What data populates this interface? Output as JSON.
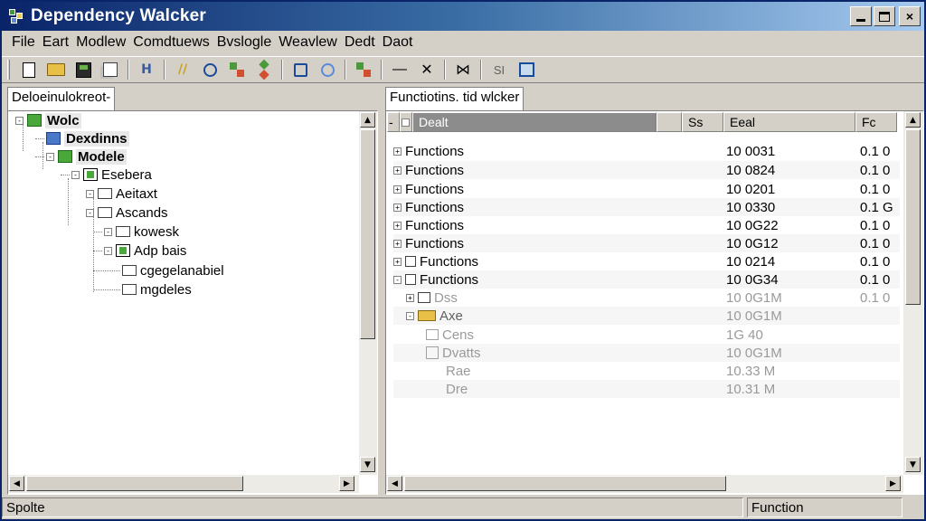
{
  "window": {
    "title": "Dependency Walcker",
    "buttons": {
      "minimize": "minimize",
      "maximize": "maximize",
      "close": "×"
    }
  },
  "menu": [
    "File",
    "Eart",
    "Modlew",
    "Comdtuews",
    "Bvslogle",
    "Weavlew",
    "Dedt",
    "Daot"
  ],
  "toolbar": {
    "icons": [
      "new-document-icon",
      "open-folder-icon",
      "save-icon",
      "copy-icon",
      "text-icon",
      "italic-icon",
      "magnify-icon",
      "tree-icon",
      "flag-icon",
      "find-icon",
      "zoom-icon",
      "module-icon",
      "minus-icon",
      "close-x-icon",
      "merge-icon",
      "split-icon",
      "frame-icon"
    ],
    "text_btn_1": "H",
    "text_btn_2": "//",
    "minus": "—",
    "x": "✕",
    "merge": "⋈",
    "split": "SI"
  },
  "left_panel": {
    "tab": "Deloeinulokreot-",
    "tree": [
      {
        "label": "Wolc",
        "icon": "green-module-icon",
        "bold": true,
        "hl": true,
        "level": 0,
        "expander": "-"
      },
      {
        "label": "Dexdinns",
        "icon": "blue-module-icon",
        "bold": true,
        "hl": true,
        "level": 1,
        "expander": "-"
      },
      {
        "label": "Modele",
        "icon": "green-module-icon",
        "bold": true,
        "hl": true,
        "level": 1,
        "expander": "-"
      },
      {
        "label": "Esebera",
        "icon": "document-icon",
        "bold": false,
        "hl": false,
        "level": 2,
        "expander": "-"
      },
      {
        "label": "Aeitaxt",
        "icon": "folder-icon",
        "bold": false,
        "hl": false,
        "level": 3,
        "expander": "-"
      },
      {
        "label": "Ascands",
        "icon": "folder-icon",
        "bold": false,
        "hl": false,
        "level": 3,
        "expander": "-"
      },
      {
        "label": "kowesk",
        "icon": "folder-icon",
        "bold": false,
        "hl": false,
        "level": 4,
        "expander": "-"
      },
      {
        "label": "Adp bais",
        "icon": "document-icon",
        "bold": false,
        "hl": false,
        "level": 4,
        "expander": "-"
      },
      {
        "label": "cgegelanabiel",
        "icon": "folder-icon",
        "bold": false,
        "hl": false,
        "level": 4,
        "expander": ""
      },
      {
        "label": "mgdeles",
        "icon": "folder-icon",
        "bold": false,
        "hl": false,
        "level": 4,
        "expander": ""
      }
    ]
  },
  "right_panel": {
    "tab": "Functiotins. tid wlcker",
    "headers": [
      "",
      "Dealt",
      "",
      "Ss",
      "Eeal",
      "Fc"
    ],
    "rows": [
      {
        "name": "Functions",
        "value": "10 0031",
        "extra": "0.1 0",
        "faded": false,
        "indent": 0,
        "icon": "none"
      },
      {
        "name": "Functions",
        "value": "10 0824",
        "extra": "0.1 0",
        "faded": false,
        "indent": 0,
        "icon": "none"
      },
      {
        "name": "Functions",
        "value": "10 0201",
        "extra": "0.1 0",
        "faded": false,
        "indent": 0,
        "icon": "none"
      },
      {
        "name": "Functions",
        "value": "10 0330",
        "extra": "0.1 G",
        "faded": false,
        "indent": 0,
        "icon": "none"
      },
      {
        "name": "Functions",
        "value": "10 0G22",
        "extra": "0.1 0",
        "faded": false,
        "indent": 0,
        "icon": "none"
      },
      {
        "name": "Functions",
        "value": "10 0G12",
        "extra": "0.1 0",
        "faded": false,
        "indent": 0,
        "icon": "none"
      },
      {
        "name": "Functions",
        "value": "10 0214",
        "extra": "0.1 0",
        "faded": false,
        "indent": 1,
        "icon": "folder"
      },
      {
        "name": "Functions",
        "value": "10 0G34",
        "extra": "0.1 0",
        "faded": false,
        "indent": 1,
        "icon": "folder"
      },
      {
        "name": "Dss",
        "value": "10 0G1M",
        "extra": "0.1 0",
        "faded": true,
        "indent": 2,
        "icon": "folder"
      },
      {
        "name": "Axe",
        "value": "10 0G1M",
        "extra": "",
        "faded": true,
        "indent": 2,
        "icon": "yellow-folder"
      },
      {
        "name": "Cens",
        "value": "1G 40",
        "extra": "",
        "faded": true,
        "indent": 3,
        "icon": "folder"
      },
      {
        "name": "Dvatts",
        "value": "10 0G1M",
        "extra": "",
        "faded": true,
        "indent": 3,
        "icon": "box"
      },
      {
        "name": "Rae",
        "value": "10.33 M",
        "extra": "",
        "faded": true,
        "indent": 3,
        "icon": "none"
      },
      {
        "name": "Dre",
        "value": "10.31 M",
        "extra": "",
        "faded": true,
        "indent": 3,
        "icon": "none"
      }
    ]
  },
  "status": {
    "left": "Spolte",
    "right": "Function"
  }
}
